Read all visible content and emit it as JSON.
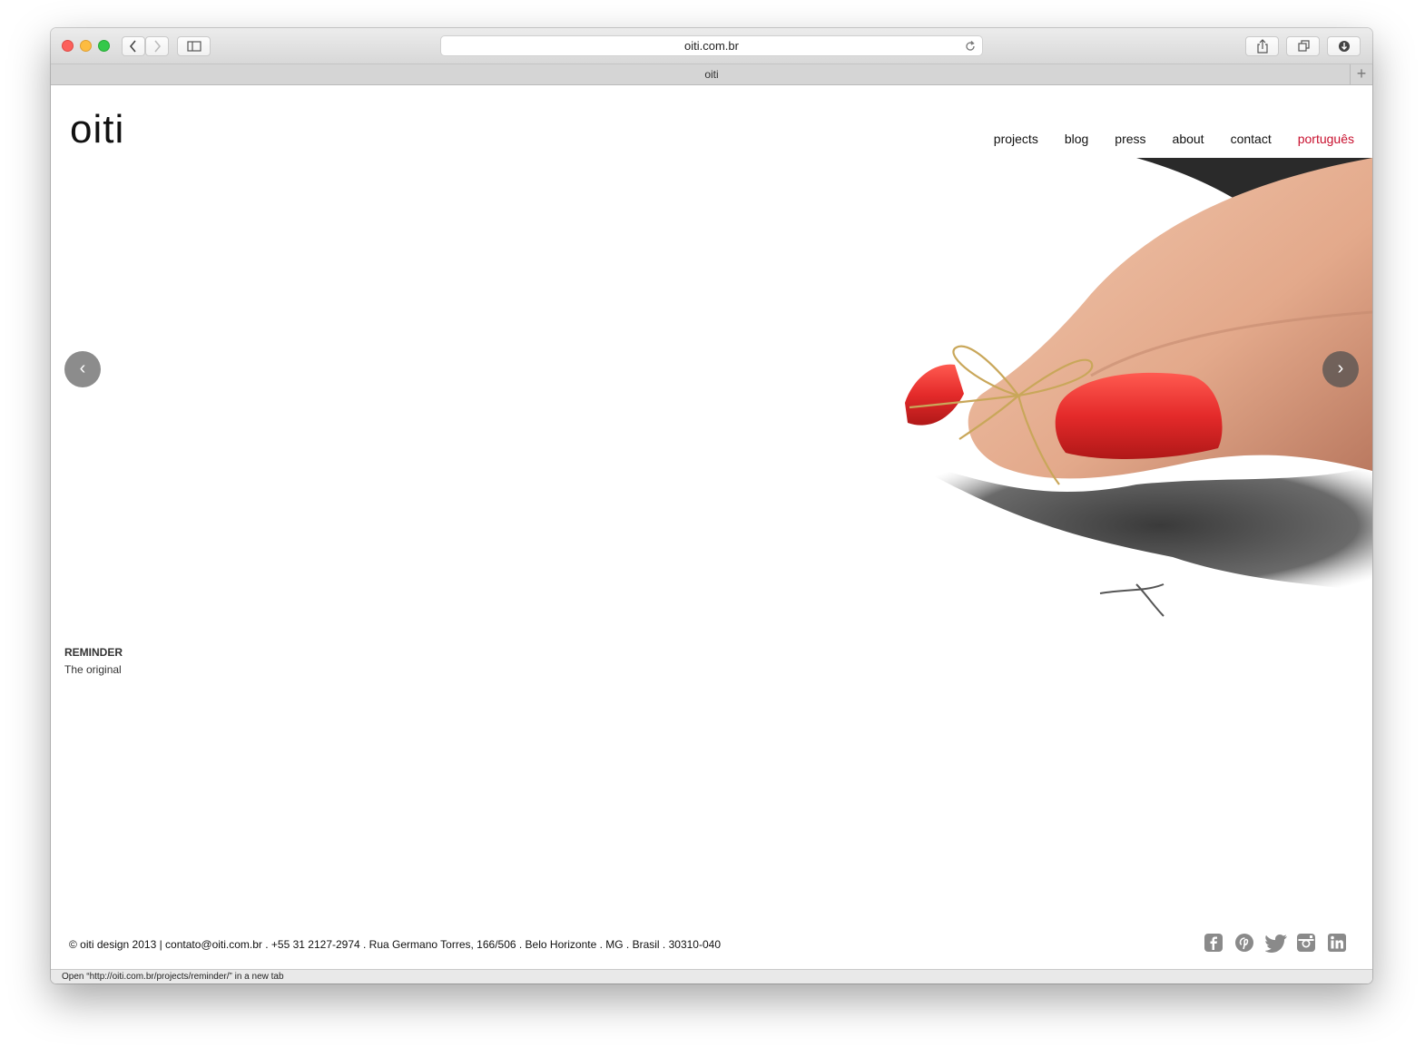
{
  "browser": {
    "url": "oiti.com.br",
    "tab_title": "oiti",
    "new_tab_glyph": "+",
    "status_text": "Open “http://oiti.com.br/projects/reminder/” in a new tab"
  },
  "site": {
    "logo": "oiti",
    "nav": {
      "projects": "projects",
      "blog": "blog",
      "press": "press",
      "about": "about",
      "contact": "contact",
      "language": "português"
    },
    "slider": {
      "prev_glyph": "‹",
      "next_glyph": "›",
      "caption_title": "REMINDER",
      "caption_subtitle": "The original"
    },
    "footer": {
      "text": "© oiti design 2013 | contato@oiti.com.br . +55 31 2127-2974 . Rua Germano Torres, 166/506 . Belo Horizonte . MG . Brasil . 30310-040",
      "social_icons": [
        "facebook-icon",
        "pinterest-icon",
        "twitter-icon",
        "instagram-icon",
        "linkedin-icon"
      ]
    }
  },
  "colors": {
    "accent_language": "#c8102e",
    "nail_red": "#e42a2a",
    "icon_gray": "#8a8a8a"
  }
}
